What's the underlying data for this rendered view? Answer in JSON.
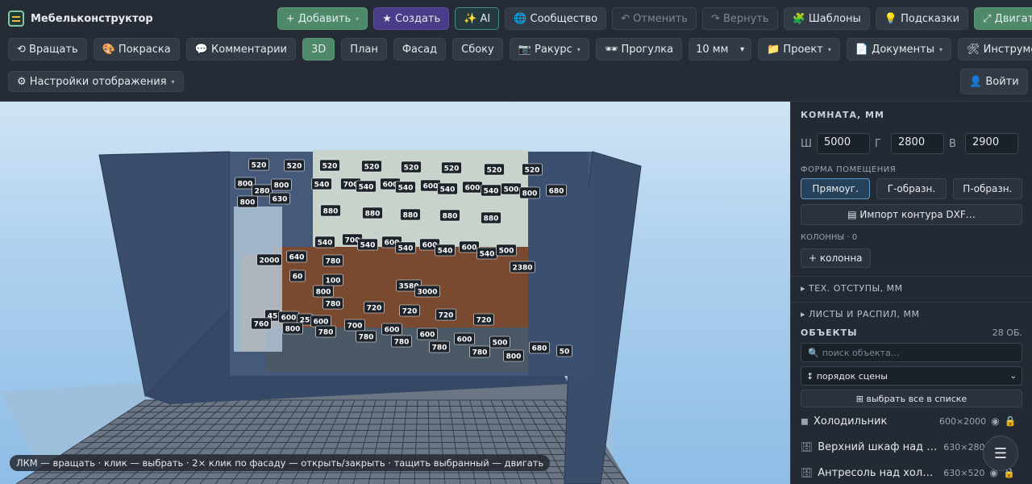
{
  "app": {
    "title": "Мебельконструктор"
  },
  "toolbar": {
    "row1": [
      {
        "id": "add",
        "label": "+ Добавить",
        "style": "green",
        "caret": true
      },
      {
        "id": "create",
        "label": "★ Создать",
        "style": "purple",
        "caret": false
      },
      {
        "id": "ai",
        "label": "✨ AI",
        "style": "teal",
        "caret": false
      },
      {
        "id": "community",
        "label": "🌐 Сообщество",
        "style": "",
        "caret": false
      },
      {
        "id": "undo",
        "label": "↶ Отменить",
        "style": "disabled",
        "caret": false
      },
      {
        "id": "redo",
        "label": "↷ Вернуть",
        "style": "disabled",
        "caret": false
      },
      {
        "id": "templates",
        "label": "🧩 Шаблоны",
        "style": "",
        "caret": false
      },
      {
        "id": "hints",
        "label": "💡 Подсказки",
        "style": "",
        "caret": false
      },
      {
        "id": "move",
        "label": "⤢ Двигать",
        "style": "green",
        "caret": false
      }
    ],
    "row2": [
      {
        "id": "rotate",
        "label": "⟲ Вращать",
        "style": "",
        "caret": false
      },
      {
        "id": "paint",
        "label": "🎨 Покраска",
        "style": "",
        "caret": false
      },
      {
        "id": "comments",
        "label": "💬 Комментарии",
        "style": "",
        "caret": false
      },
      {
        "id": "view3d",
        "label": "3D",
        "style": "green",
        "caret": false
      },
      {
        "id": "plan",
        "label": "План",
        "style": "",
        "caret": false
      },
      {
        "id": "facade",
        "label": "Фасад",
        "style": "",
        "caret": false
      },
      {
        "id": "side",
        "label": "Сбоку",
        "style": "",
        "caret": false
      },
      {
        "id": "angle",
        "label": "📷 Ракурс",
        "style": "",
        "caret": true
      },
      {
        "id": "walk",
        "label": "🕶 Прогулка",
        "style": "",
        "caret": false
      }
    ],
    "step_select": "10 мм",
    "row2b": [
      {
        "id": "project",
        "label": "📁 Проект",
        "style": "",
        "caret": true
      },
      {
        "id": "documents",
        "label": "📄 Документы",
        "style": "",
        "caret": true
      },
      {
        "id": "tools",
        "label": "🛠 Инструменты",
        "style": "",
        "caret": true
      }
    ],
    "display_settings": "⚙ Настройки отображения",
    "login": "👤 Войти"
  },
  "viewport": {
    "hint": "ЛКМ — вращать · клик — выбрать · 2× клик по фасаду — открыть/закрыть · тащить выбранный — двигать",
    "dim_labels": [
      "520",
      "520",
      "520",
      "520",
      "520",
      "520",
      "520",
      "520",
      "800",
      "280",
      "800",
      "630",
      "800",
      "540",
      "700",
      "540",
      "600",
      "540",
      "600",
      "540",
      "600",
      "540",
      "500",
      "800",
      "680",
      "880",
      "880",
      "880",
      "880",
      "880",
      "540",
      "700",
      "540",
      "600",
      "540",
      "600",
      "540",
      "600",
      "540",
      "500",
      "2000",
      "640",
      "780",
      "2380",
      "60",
      "100",
      "800",
      "3580",
      "3000",
      "780",
      "720",
      "720",
      "720",
      "720",
      "45",
      "600",
      "25",
      "600",
      "760",
      "800",
      "780",
      "700",
      "600",
      "600",
      "780",
      "780",
      "600",
      "780",
      "780",
      "500",
      "800",
      "680",
      "50"
    ]
  },
  "panel": {
    "room_title": "КОМНАТА, ММ",
    "dims": [
      {
        "label": "Ш",
        "value": "5000"
      },
      {
        "label": "Г",
        "value": "2800"
      },
      {
        "label": "В",
        "value": "2900"
      }
    ],
    "shape_title": "ФОРМА ПОМЕЩЕНИЯ",
    "shapes": [
      {
        "label": "Прямоуг.",
        "active": true
      },
      {
        "label": "Г-образн.",
        "active": false
      },
      {
        "label": "П-образн.",
        "active": false
      }
    ],
    "import_label": "▤ Импорт контура DXF…",
    "columns": "КОЛОННЫ · 0",
    "add_column": "+ колонна",
    "tech_offsets": "▸ ТЕХ. ОТСТУПЫ, ММ",
    "sheets": "▸ ЛИСТЫ И РАСПИЛ, ММ",
    "objects_title": "ОБЪЕКТЫ",
    "objects_count": "28 ОБ.",
    "search_placeholder": "поиск объекта…",
    "order": "↕ порядок сцены",
    "select_all": "⊞ выбрать все в списке",
    "objects": [
      {
        "name": "Холодильник",
        "size": "600×2000"
      },
      {
        "name": "Верхний шкаф над холо…",
        "size": "630×280"
      },
      {
        "name": "Антресоль над холоди…",
        "size": "630×520"
      }
    ]
  }
}
